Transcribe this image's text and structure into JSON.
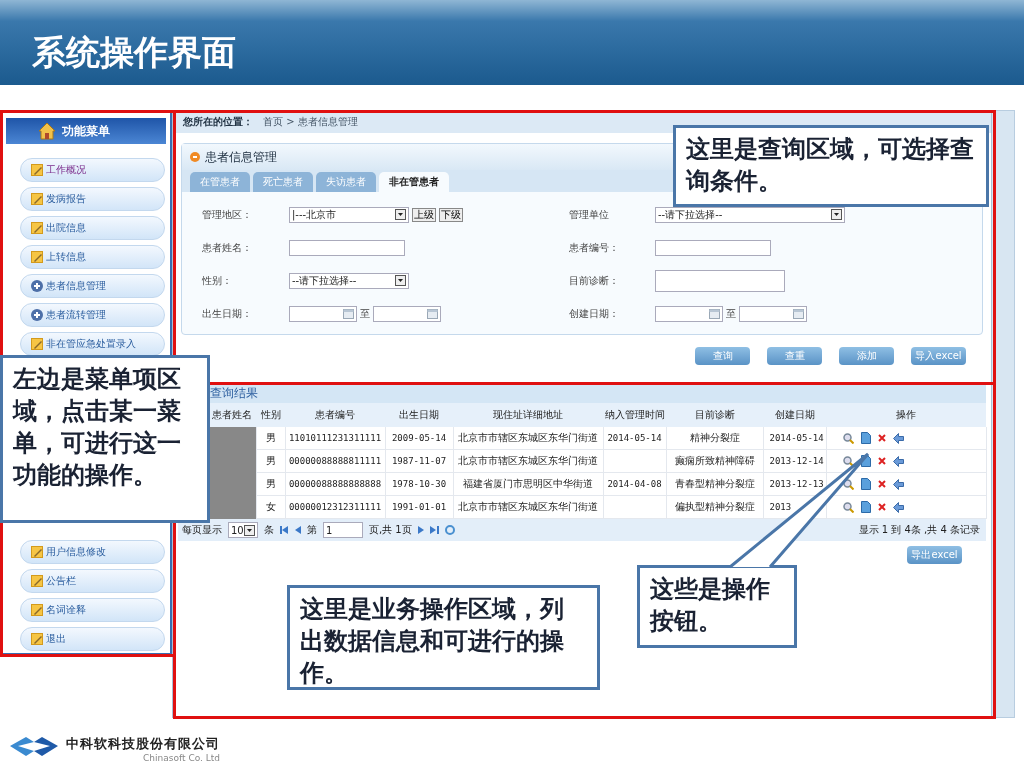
{
  "slide_title": "系统操作界面",
  "sidebar": {
    "title": "功能菜单",
    "items_top": [
      {
        "label": "工作概况",
        "kind": "note",
        "visited": true
      },
      {
        "label": "发病报告",
        "kind": "note",
        "visited": false
      },
      {
        "label": "出院信息",
        "kind": "note",
        "visited": false
      },
      {
        "label": "上转信息",
        "kind": "note",
        "visited": false
      },
      {
        "label": "患者信息管理",
        "kind": "plus",
        "visited": false
      },
      {
        "label": "患者流转管理",
        "kind": "plus",
        "visited": false
      },
      {
        "label": "非在管应急处置录入",
        "kind": "note",
        "visited": false
      }
    ],
    "items_bottom": [
      {
        "label": "用户信息修改",
        "kind": "note",
        "visited": false
      },
      {
        "label": "公告栏",
        "kind": "note",
        "visited": false
      },
      {
        "label": "名词诠释",
        "kind": "note",
        "visited": false
      },
      {
        "label": "退出",
        "kind": "note",
        "visited": false
      }
    ]
  },
  "breadcrumb": {
    "label": "您所在的位置：",
    "path": "首页 > 患者信息管理"
  },
  "panel_title": "患者信息管理",
  "tabs": [
    {
      "label": "在管患者",
      "selected": false
    },
    {
      "label": "死亡患者",
      "selected": false
    },
    {
      "label": "失访患者",
      "selected": false
    },
    {
      "label": "非在管患者",
      "selected": true
    }
  ],
  "form": {
    "left": [
      {
        "label": "管理地区：",
        "kind": "select",
        "value": "|---北京市",
        "extra": [
          "上级",
          "下级"
        ]
      },
      {
        "label": "患者姓名：",
        "kind": "text"
      },
      {
        "label": "性别：",
        "kind": "select",
        "value": "--请下拉选择--"
      },
      {
        "label": "出生日期：",
        "kind": "daterange",
        "separator": "至"
      }
    ],
    "right": [
      {
        "label": "管理单位",
        "kind": "select",
        "value": "--请下拉选择--"
      },
      {
        "label": "患者编号：",
        "kind": "text"
      },
      {
        "label": "目前诊断：",
        "kind": "textarea"
      },
      {
        "label": "创建日期：",
        "kind": "daterange",
        "separator": "至"
      }
    ]
  },
  "buttons": [
    "查询",
    "查重",
    "添加",
    "导入excel"
  ],
  "results": {
    "title": "查询结果",
    "columns": [
      "患者姓名",
      "性别",
      "患者编号",
      "出生日期",
      "现住址详细地址",
      "纳入管理时间",
      "目前诊断",
      "创建日期",
      "操作"
    ],
    "rows": [
      {
        "gender": "男",
        "id": "11010111231311111",
        "birth": "2009-05-14",
        "address": "北京市市辖区东城区东华门街道",
        "inclusion": "2014-05-14",
        "diagnosis": "精神分裂症",
        "created": "2014-05-14"
      },
      {
        "gender": "男",
        "id": "00000088888811111",
        "birth": "1987-11-07",
        "address": "北京市市辖区东城区东华门街道",
        "diagnosis": "癫痫所致精神障碍",
        "created": "2013-12-14"
      },
      {
        "gender": "男",
        "id": "00000088888888888",
        "birth": "1978-10-30",
        "address": "福建省厦门市思明区中华街道",
        "inclusion": "2014-04-08",
        "diagnosis": "青春型精神分裂症",
        "created": "2013-12-13"
      },
      {
        "gender": "女",
        "id": "00000012312311111",
        "birth": "1991-01-01",
        "address": "北京市市辖区东城区东华门街道",
        "diagnosis": "偏执型精神分裂症",
        "created": "2013"
      }
    ]
  },
  "pager": {
    "per_page_label": "每页显示",
    "page_size": "10",
    "unit": "条",
    "page_prefix": "第",
    "page": "1",
    "page_suffix": "页,共 1页",
    "summary": "显示 1 到 4条 ,共 4 条记录"
  },
  "export_button": "导出excel",
  "callouts": [
    {
      "text": "这里是查询区域，可选择查询条件。"
    },
    {
      "text": "左边是菜单项区域，点击某一菜单，可进行这一功能的操作。"
    },
    {
      "text": "这里是业务操作区域，列出数据信息和可进行的操作。"
    },
    {
      "text": "这些是操作按钮。"
    }
  ],
  "footer": {
    "company": "中科软科技股份有限公司",
    "company_en": "Chinasoft Co. Ltd"
  }
}
